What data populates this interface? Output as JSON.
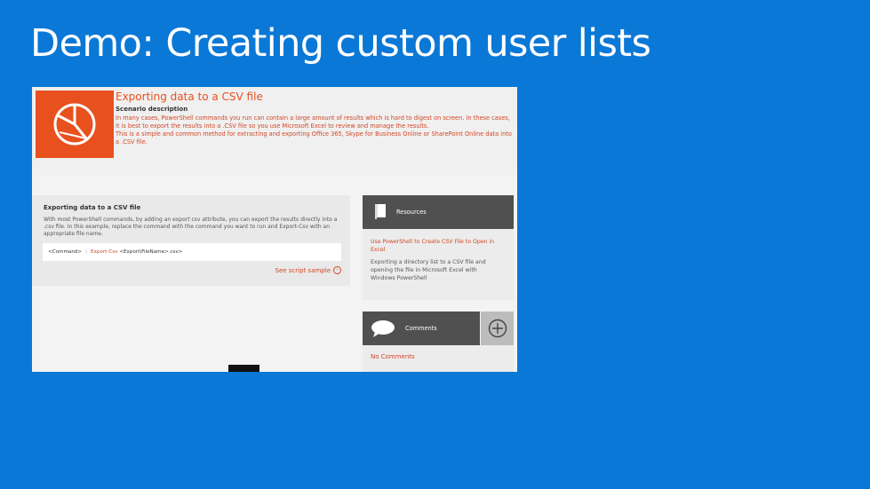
{
  "slide": {
    "title": "Demo: Creating custom user lists"
  },
  "header": {
    "icon": "pie-chart-icon",
    "title": "Exporting data to a CSV file",
    "subtitle": "Scenario description",
    "description": [
      "In many cases, PowerShell commands you run can contain a large amount of results which is hard to digest on screen. In these cases, it is best to export the results into a .CSV file so you use Microsoft Excel to review and manage the results.",
      "This is a simple and common method for extracting and exporting Office 365, Skype for Business Online or SharePoint Online data into a .CSV file."
    ]
  },
  "panel": {
    "title": "Exporting data to a CSV file",
    "body": "With most PowerShell commands, by adding an export csv attribute, you can export the results directly into a .csv file. In this example, replace the command with the command you want to run and Export-Csv with an appropriate file name.",
    "code": {
      "command": "<Command>",
      "pipe": "|",
      "cmdlet": "Export-Csv",
      "file": "<Export\\FileName>.csv>"
    },
    "link": "See script sample"
  },
  "resources": {
    "title": "Resources",
    "link": "Use PowerShell to Create CSV File to Open in Excel",
    "text": "Exporting a directory list to a CSV file and opening the file in Microsoft Excel with Windows PowerShell"
  },
  "comments": {
    "title": "Comments",
    "empty": "No Comments"
  },
  "colors": {
    "background": "#0a78d7",
    "accent": "#e8501d",
    "dark": "#505050"
  }
}
